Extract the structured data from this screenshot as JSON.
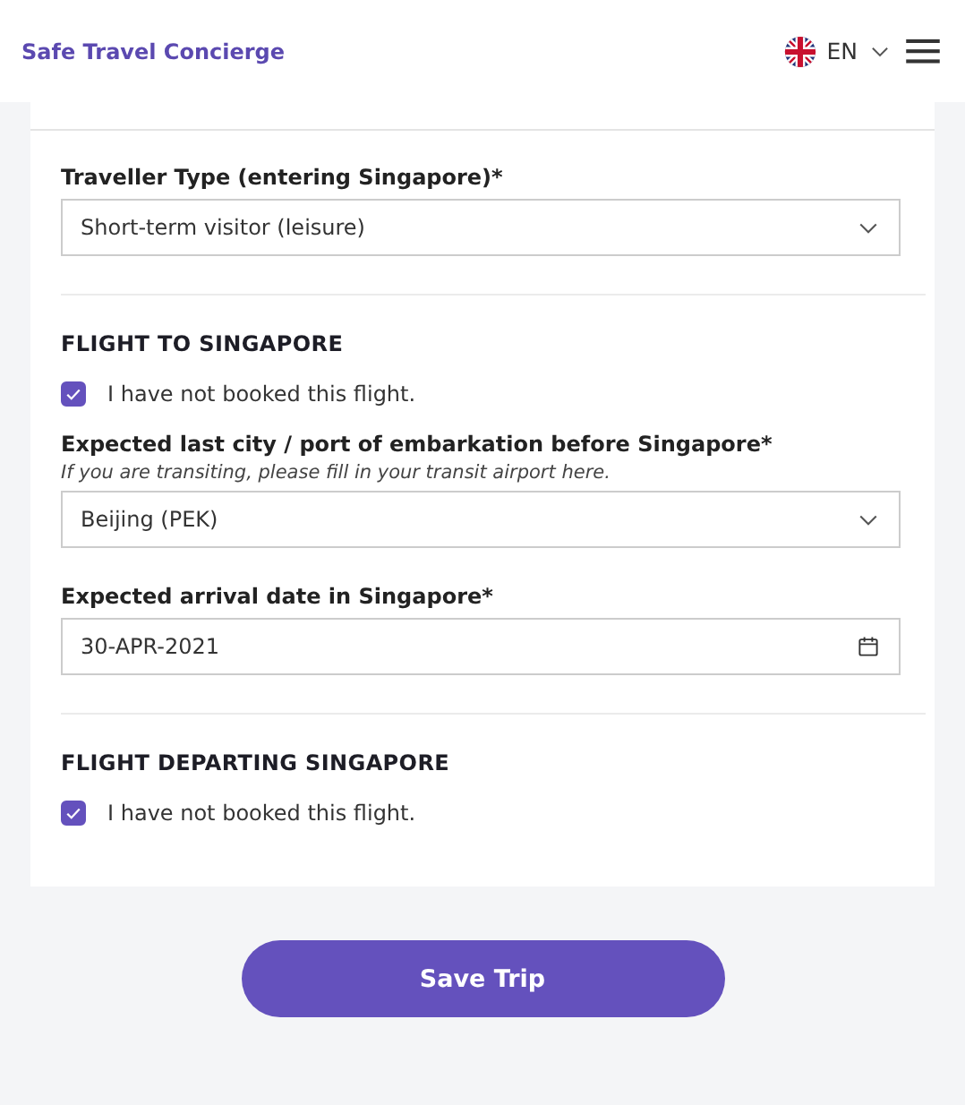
{
  "header": {
    "brand": "Safe Travel Concierge",
    "language": "EN"
  },
  "sections": [
    {
      "items": [
        {
          "kind": "select",
          "label": "Traveller Type (entering Singapore)*",
          "value": "Short-term visitor (leisure)"
        }
      ]
    },
    {
      "heading": "FLIGHT TO SINGAPORE",
      "items": [
        {
          "kind": "checkbox",
          "label": "I have not booked this flight.",
          "checked": true
        },
        {
          "kind": "select",
          "label": "Expected last city / port of embarkation before Singapore*",
          "hint": "If you are transiting, please fill in your transit airport here.",
          "value": "Beijing (PEK)"
        },
        {
          "kind": "date",
          "label": "Expected arrival date in Singapore*",
          "value": "30-APR-2021"
        }
      ]
    },
    {
      "heading": "FLIGHT DEPARTING SINGAPORE",
      "items": [
        {
          "kind": "checkbox",
          "label": "I have not booked this flight.",
          "checked": true
        }
      ]
    }
  ],
  "save_button": "Save Trip"
}
